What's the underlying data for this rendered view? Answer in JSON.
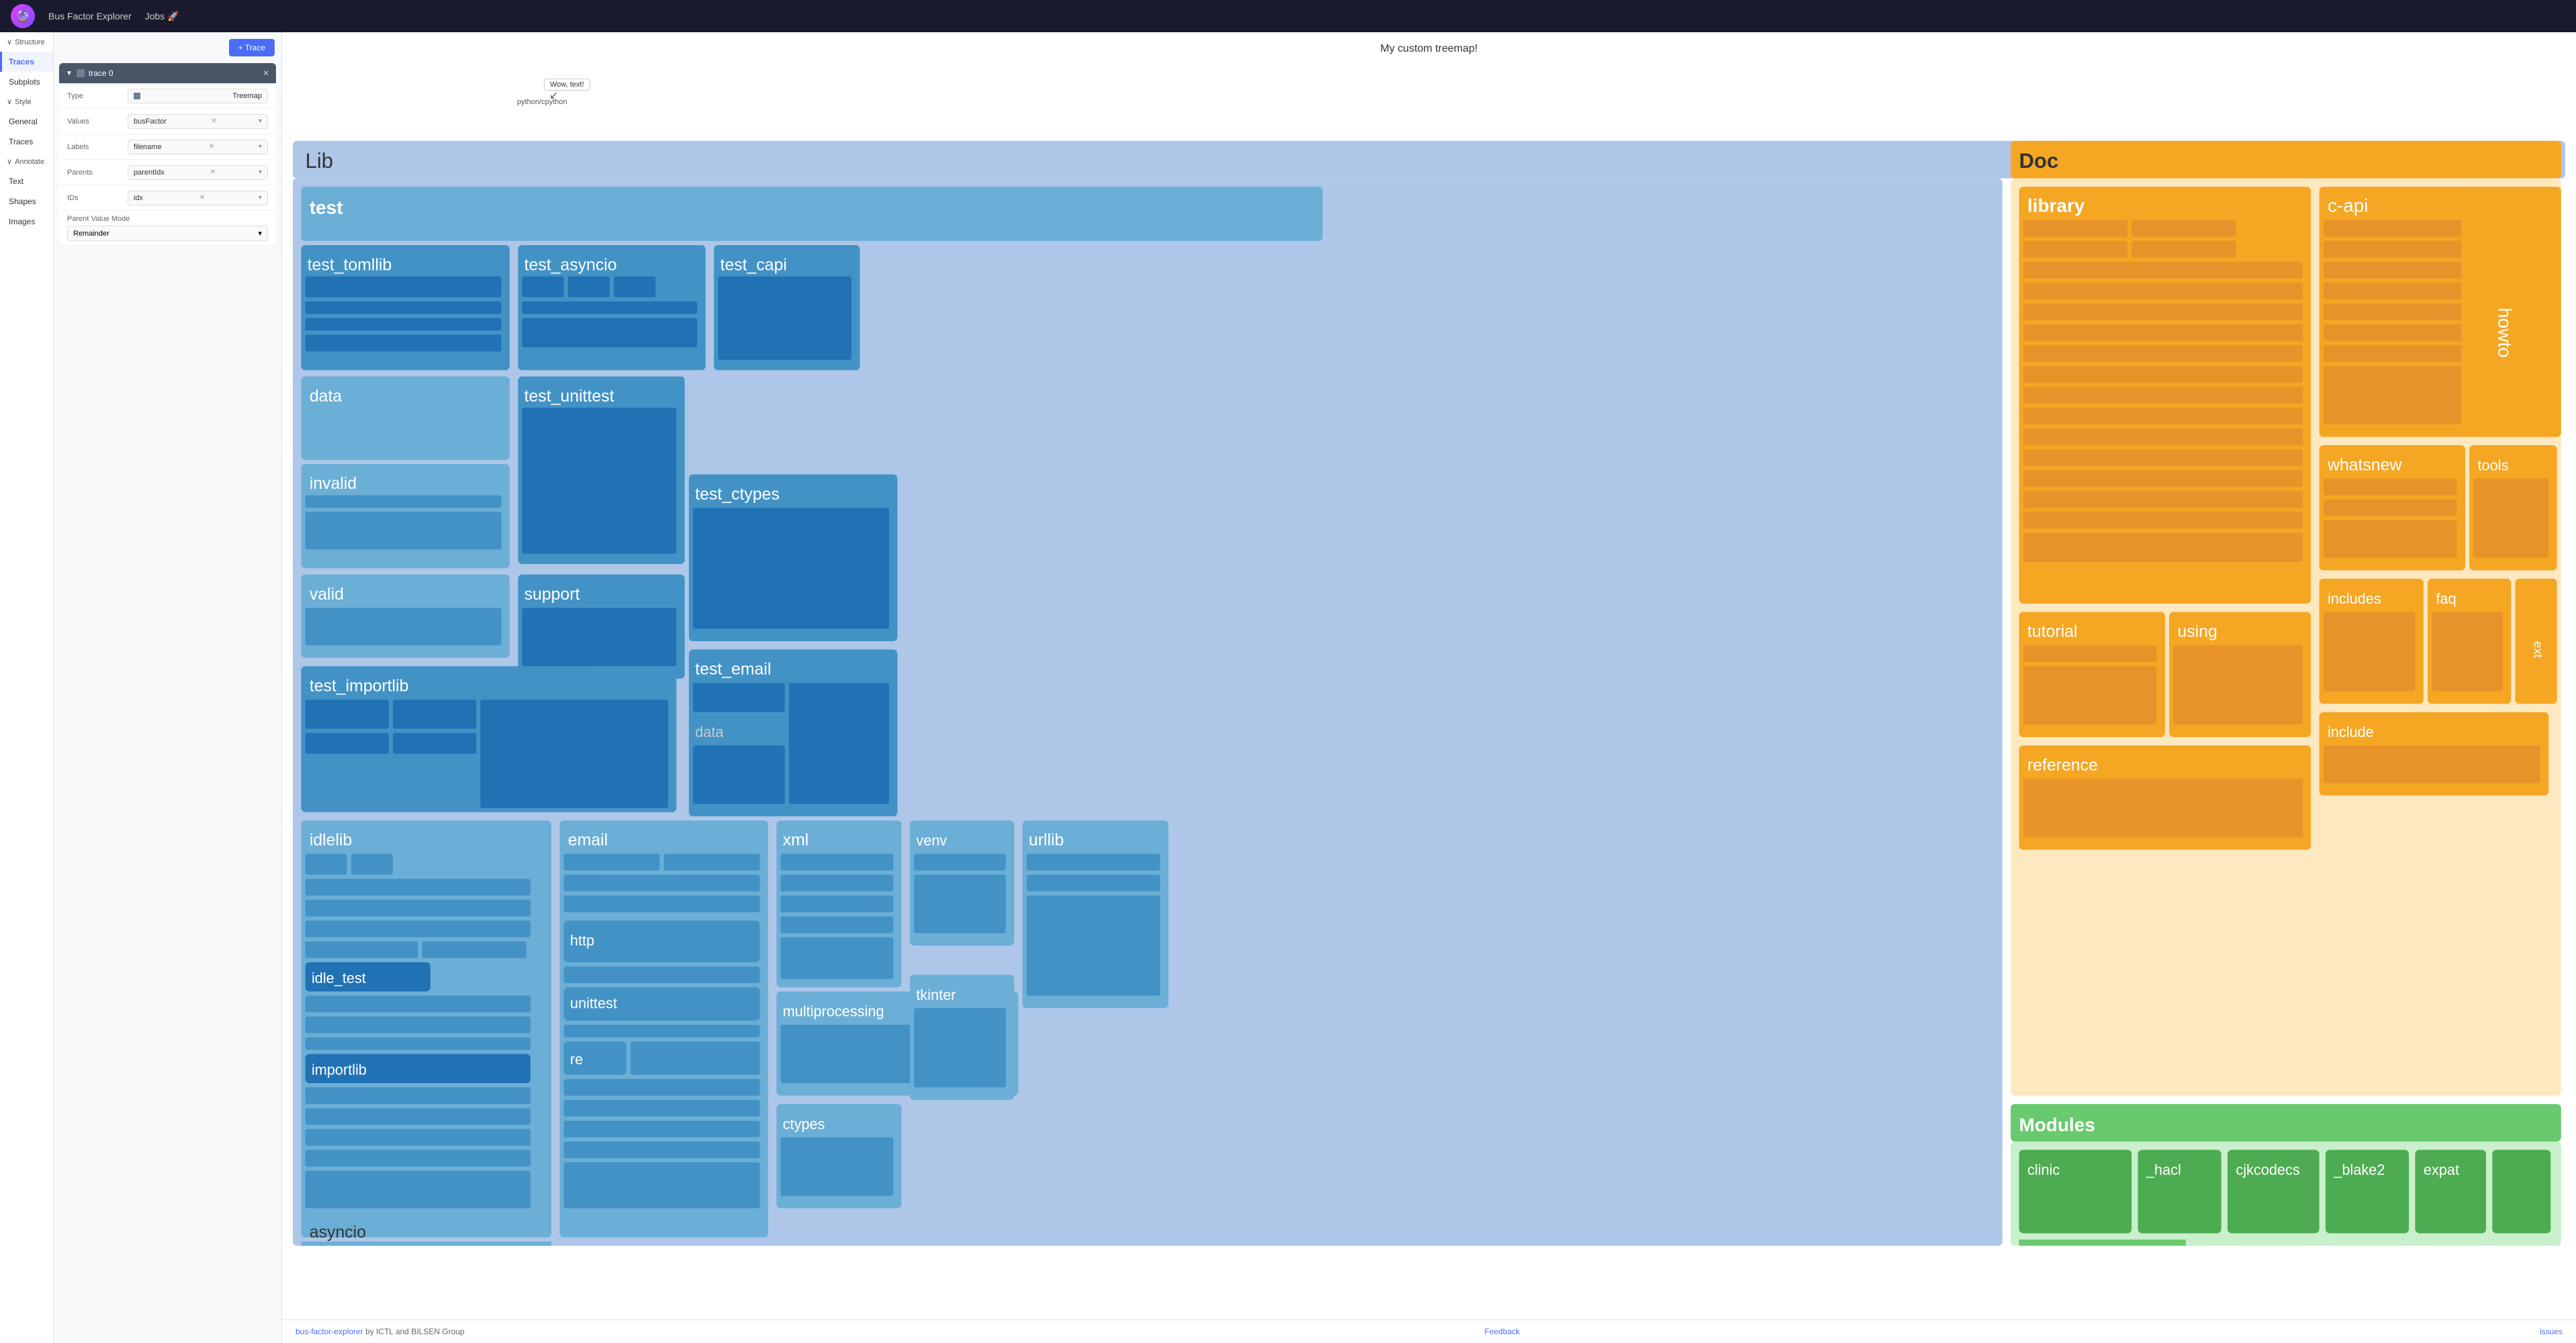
{
  "nav": {
    "app_title": "Bus Factor Explorer",
    "jobs_link": "Jobs 🚀",
    "logo_emoji": "🔮"
  },
  "sidebar": {
    "structure_label": "Structure",
    "sections": [
      {
        "id": "structure",
        "label": "Structure",
        "collapsible": true
      },
      {
        "id": "traces",
        "label": "Traces",
        "active": true
      },
      {
        "id": "subplots",
        "label": "Subplots"
      },
      {
        "id": "style",
        "label": "Style",
        "collapsible": true
      },
      {
        "id": "general",
        "label": "General"
      },
      {
        "id": "traces2",
        "label": "Traces"
      },
      {
        "id": "annotate",
        "label": "Annotate",
        "collapsible": true
      },
      {
        "id": "text",
        "label": "Text"
      },
      {
        "id": "shapes",
        "label": "Shapes"
      },
      {
        "id": "images",
        "label": "Images"
      }
    ]
  },
  "panel": {
    "add_trace_label": "+ Trace",
    "trace_name": "trace 0",
    "fields": {
      "type_label": "Type",
      "type_value": "Treemap",
      "values_label": "Values",
      "values_value": "busFactor",
      "labels_label": "Labels",
      "labels_value": "filename",
      "parents_label": "Parents",
      "parents_value": "parentIdx",
      "ids_label": "IDs",
      "ids_value": "idx",
      "parent_value_mode_label": "Parent Value Mode",
      "parent_value_mode_value": "Remainder"
    }
  },
  "chart": {
    "title": "My custom treemap!",
    "annotation_text": "Wow, text!",
    "python_label": "python/cpython"
  },
  "footer": {
    "left_text": "bus-factor-explorer",
    "left_suffix": " by ICTL and BILSEN Group",
    "feedback": "Feedback",
    "issues": "issues"
  }
}
